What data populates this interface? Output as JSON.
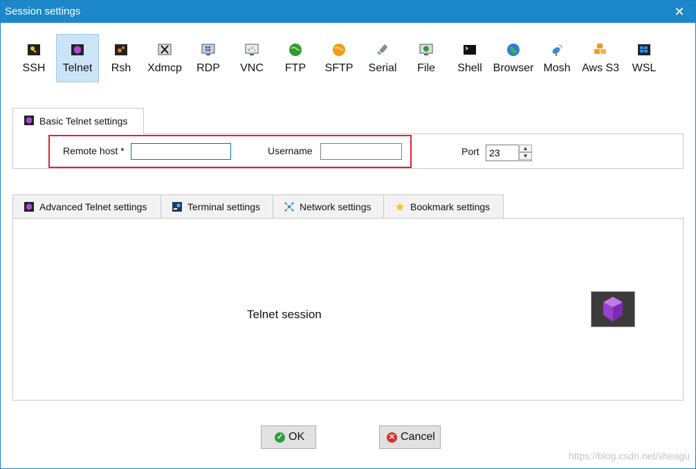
{
  "window": {
    "title": "Session settings",
    "close_glyph": "✕"
  },
  "session_types": [
    {
      "label": "SSH",
      "icon": "key-icon"
    },
    {
      "label": "Telnet",
      "icon": "telnet-gem-icon",
      "active": true
    },
    {
      "label": "Rsh",
      "icon": "rsh-icon"
    },
    {
      "label": "Xdmcp",
      "icon": "xdmcp-icon"
    },
    {
      "label": "RDP",
      "icon": "rdp-monitor-icon"
    },
    {
      "label": "VNC",
      "icon": "vnc-monitor-icon"
    },
    {
      "label": "FTP",
      "icon": "ftp-globe-icon"
    },
    {
      "label": "SFTP",
      "icon": "sftp-globe-icon"
    },
    {
      "label": "Serial",
      "icon": "serial-plug-icon"
    },
    {
      "label": "File",
      "icon": "file-monitor-icon"
    },
    {
      "label": "Shell",
      "icon": "shell-terminal-icon"
    },
    {
      "label": "Browser",
      "icon": "browser-globe-icon"
    },
    {
      "label": "Mosh",
      "icon": "mosh-satellite-icon"
    },
    {
      "label": "Aws S3",
      "icon": "aws-cubes-icon"
    },
    {
      "label": "WSL",
      "icon": "wsl-windows-icon"
    }
  ],
  "basic": {
    "tab_label": "Basic Telnet settings",
    "remote_host_label": "Remote host *",
    "remote_host_value": "",
    "username_label": "Username",
    "username_value": "",
    "port_label": "Port",
    "port_value": "23"
  },
  "tabs": [
    {
      "label": "Advanced Telnet settings",
      "icon": "telnet-gem-icon"
    },
    {
      "label": "Terminal settings",
      "icon": "terminal-settings-icon"
    },
    {
      "label": "Network settings",
      "icon": "network-icon"
    },
    {
      "label": "Bookmark settings",
      "icon": "star-icon"
    }
  ],
  "panel": {
    "session_label": "Telnet session",
    "badge_icon": "purple-gem-icon"
  },
  "buttons": {
    "ok": "OK",
    "cancel": "Cancel"
  },
  "watermark": "https://blog.csdn.net/sheagu",
  "colors": {
    "titlebar": "#1c88c9",
    "active_type": "#cce4f7",
    "highlight_box": "#e0222b",
    "ok_green": "#2e9e3e",
    "cancel_red": "#d9302f"
  }
}
